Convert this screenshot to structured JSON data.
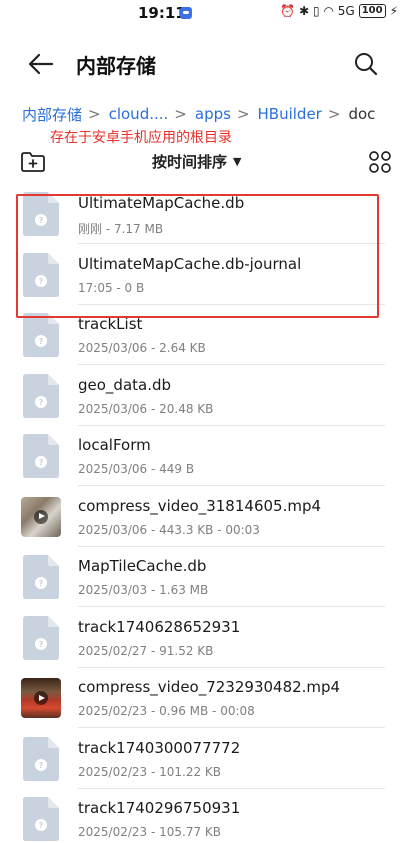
{
  "status_bar": {
    "time": "19:11",
    "icons_text": "⏰ ✱ ▯ ◠ 5G",
    "battery": "100"
  },
  "header": {
    "title": "内部存储"
  },
  "breadcrumb": [
    {
      "label": "内部存储",
      "current": false
    },
    {
      "label": "cloud....",
      "current": false
    },
    {
      "label": "apps",
      "current": false
    },
    {
      "label": "HBuilder",
      "current": false
    },
    {
      "label": "doc",
      "current": true
    }
  ],
  "annotation": "存在于安卓手机应用的根目录",
  "toolbar": {
    "sort_label": "按时间排序",
    "sort_caret": "▼"
  },
  "files": [
    {
      "name": "UltimateMapCache.db",
      "meta": "刚刚 - 7.17 MB",
      "kind": "doc"
    },
    {
      "name": "UltimateMapCache.db-journal",
      "meta": "17:05 - 0 B",
      "kind": "doc"
    },
    {
      "name": "trackList",
      "meta": "2025/03/06 - 2.64 KB",
      "kind": "doc"
    },
    {
      "name": "geo_data.db",
      "meta": "2025/03/06 - 20.48 KB",
      "kind": "doc"
    },
    {
      "name": "localForm",
      "meta": "2025/03/06 - 449 B",
      "kind": "doc"
    },
    {
      "name": "compress_video_31814605.mp4",
      "meta": "2025/03/06 - 443.3 KB - 00:03",
      "kind": "video1"
    },
    {
      "name": "MapTileCache.db",
      "meta": "2025/03/03 - 1.63 MB",
      "kind": "doc"
    },
    {
      "name": "track1740628652931",
      "meta": "2025/02/27 - 91.52 KB",
      "kind": "doc"
    },
    {
      "name": "compress_video_7232930482.mp4",
      "meta": "2025/02/23 - 0.96 MB - 00:08",
      "kind": "video2"
    },
    {
      "name": "track1740300077772",
      "meta": "2025/02/23 - 101.22 KB",
      "kind": "doc"
    },
    {
      "name": "track1740296750931",
      "meta": "2025/02/23 - 105.77 KB",
      "kind": "doc"
    }
  ],
  "colors": {
    "accent": "#2a6fde",
    "annotation": "#e8302a",
    "highlight_border": "#e23a33",
    "doc_icon": "#c9d3df"
  }
}
